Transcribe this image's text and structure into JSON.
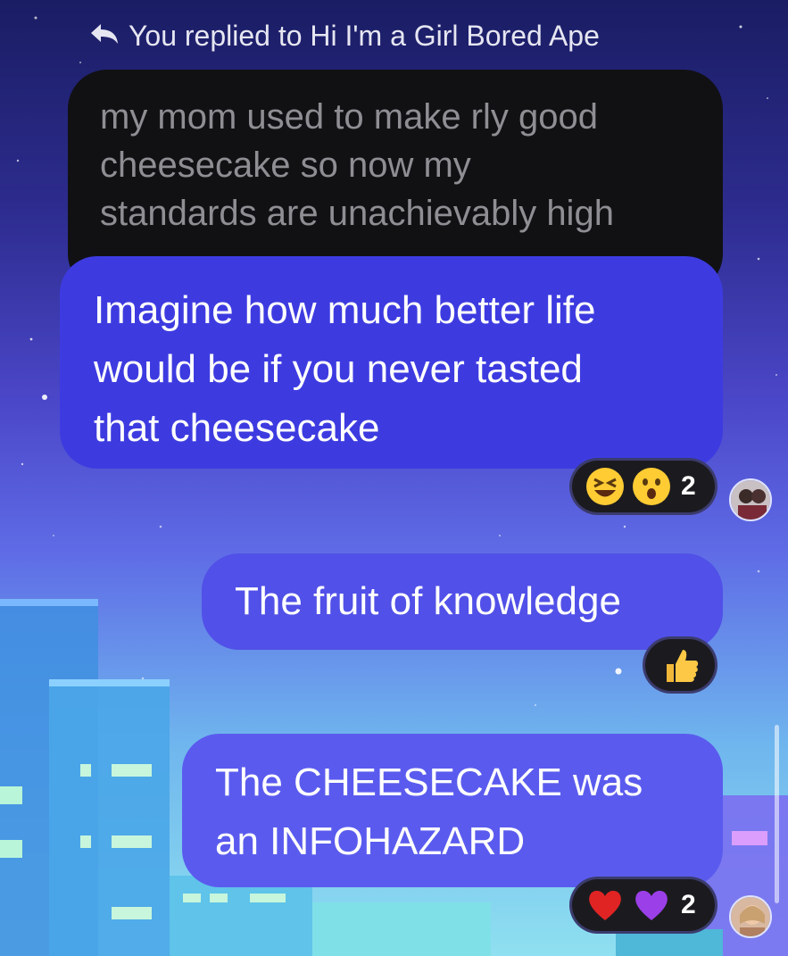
{
  "reply_header": {
    "icon": "reply-arrow-icon",
    "text": "You replied to Hi I'm a Girl Bored Ape"
  },
  "quoted_message": {
    "lines": [
      "my mom used to make rly good",
      "cheesecake so now my",
      "standards are unachievably high"
    ]
  },
  "messages": [
    {
      "lines": [
        "Imagine how much better life",
        "would be if you never tasted",
        "that cheesecake"
      ],
      "reactions": {
        "emojis": [
          "laughing-face-icon",
          "surprised-face-icon"
        ],
        "count": "2"
      },
      "has_avatar": true
    },
    {
      "lines": [
        "The fruit of knowledge"
      ],
      "reactions": {
        "emojis": [
          "thumbs-up-icon"
        ],
        "count": ""
      },
      "has_avatar": false
    },
    {
      "lines": [
        "The CHEESECAKE was",
        "an INFOHAZARD"
      ],
      "reactions": {
        "emojis": [
          "red-heart-icon",
          "purple-heart-icon"
        ],
        "count": "2"
      },
      "has_avatar": true
    }
  ],
  "colors": {
    "quoted_bubble": "#111114",
    "quoted_text": "#8e8e93",
    "bubble_1": "#3d3be0",
    "bubble_2": "#5150e8",
    "bubble_3": "#5a5bee",
    "reaction_pill": "#1b1b1f"
  }
}
